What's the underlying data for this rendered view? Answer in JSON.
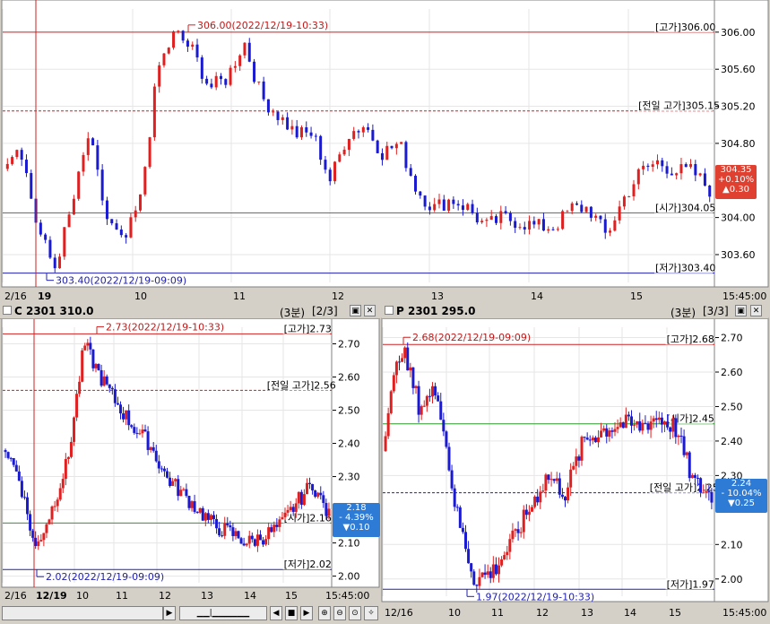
{
  "charts": [
    {
      "id": "main",
      "header_title": "",
      "current": {
        "price": "304.35",
        "change": "+0.10%",
        "diff": "▲0.30"
      },
      "ylim": [
        303.3,
        306.25
      ],
      "yticks": [
        "306.00",
        "305.60",
        "305.20",
        "304.80",
        "304.00",
        "303.60"
      ],
      "xticks": [
        "2/16",
        "19",
        "10",
        "11",
        "12",
        "13",
        "14",
        "15",
        "15:45:00"
      ],
      "levels": [
        {
          "name": "high",
          "value": 306.0,
          "label": "[고가]306.00",
          "style": "solid",
          "color": "#d02020"
        },
        {
          "name": "prev-high",
          "value": 305.15,
          "label": "[전일 고가]305.15",
          "style": "dashed",
          "color": "#d02020"
        },
        {
          "name": "open",
          "value": 304.05,
          "label": "[시가]304.05",
          "style": "solid",
          "color": "#2a9a2a"
        },
        {
          "name": "low",
          "value": 303.4,
          "label": "[저가]303.40",
          "style": "solid",
          "color": "#2020b0"
        }
      ],
      "annotations": {
        "high": "306.00(2022/12/19-10:33)",
        "low": "303.40(2022/12/19-09:09)"
      }
    },
    {
      "id": "call",
      "header_title": "C 2301 310.0",
      "header_meta": "(3분)",
      "header_page": "[2/3]",
      "current": {
        "price": "2.18",
        "change": "- 4.39%",
        "diff": "▼0.10"
      },
      "ylim": [
        1.98,
        2.75
      ],
      "yticks": [
        "2.70",
        "2.60",
        "2.50",
        "2.40",
        "2.30",
        "2.20",
        "2.10",
        "2.00"
      ],
      "xticks": [
        "2/16",
        "12/19",
        "10",
        "11",
        "12",
        "13",
        "14",
        "15",
        "15:45:00"
      ],
      "levels": [
        {
          "name": "high",
          "value": 2.73,
          "label": "[고가]2.73",
          "style": "solid",
          "color": "#d02020"
        },
        {
          "name": "prev-high",
          "value": 2.56,
          "label": "[전일 고가]2.56",
          "style": "dashed",
          "color": "#d02020"
        },
        {
          "name": "open",
          "value": 2.16,
          "label": "[시가]2.16",
          "style": "solid",
          "color": "#2a9a2a"
        },
        {
          "name": "low",
          "value": 2.02,
          "label": "[저가]2.02",
          "style": "solid",
          "color": "#2020b0"
        }
      ],
      "annotations": {
        "high": "2.73(2022/12/19-10:33)",
        "low": "2.02(2022/12/19-09:09)"
      }
    },
    {
      "id": "put",
      "header_title": "P 2301 295.0",
      "header_meta": "(3분)",
      "header_page": "[3/3]",
      "current": {
        "price": "2.24",
        "change": "- 10.04%",
        "diff": "▼0.25"
      },
      "ylim": [
        1.95,
        2.73
      ],
      "yticks": [
        "2.70",
        "2.60",
        "2.50",
        "2.40",
        "2.30",
        "2.10",
        "2.00"
      ],
      "xticks": [
        "12/16",
        "10",
        "11",
        "12",
        "13",
        "14",
        "15",
        "15:45:00"
      ],
      "levels": [
        {
          "name": "high",
          "value": 2.68,
          "label": "[고가]2.68",
          "style": "solid",
          "color": "#d02020"
        },
        {
          "name": "open",
          "value": 2.45,
          "label": "[시가]2.45",
          "style": "solid",
          "color": "#2a9a2a"
        },
        {
          "name": "prev-high",
          "value": 2.25,
          "label": "[전일 고가]2.25",
          "style": "dashed",
          "color": "#2020b0"
        },
        {
          "name": "low",
          "value": 1.97,
          "label": "[저가]1.97",
          "style": "solid",
          "color": "#2020b0"
        }
      ],
      "annotations": {
        "high": "2.68(2022/12/19-09:09)",
        "low": "1.97(2022/12/19-10:33)"
      }
    }
  ],
  "toolbar": {
    "zoom_in_icon": "zoom-in-icon",
    "zoom_out_icon": "zoom-out-icon"
  },
  "colors": {
    "up": "#e02020",
    "down": "#1a1ad0",
    "accent": "#2e7bd6"
  }
}
